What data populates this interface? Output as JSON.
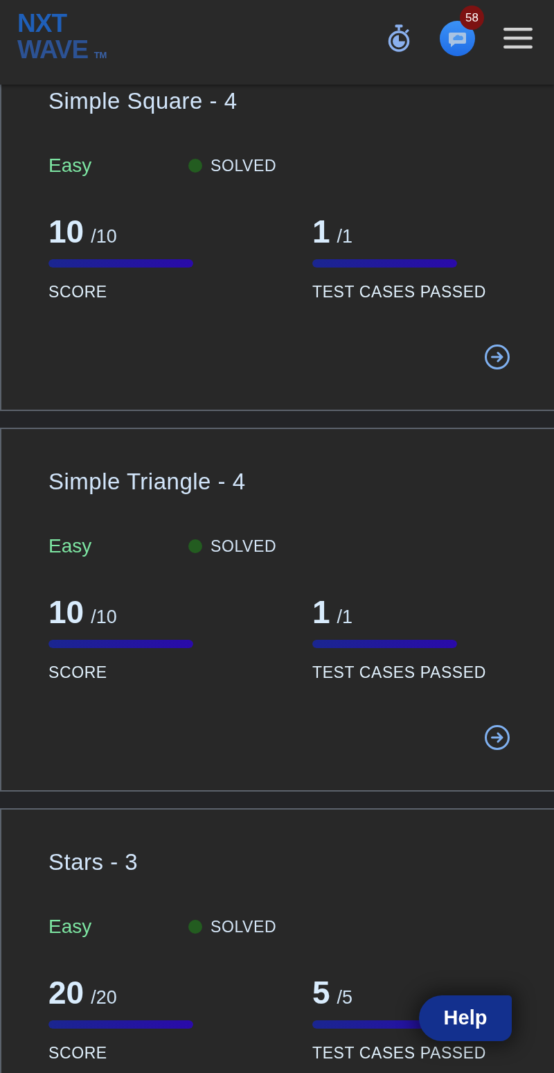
{
  "header": {
    "logo": {
      "line_1": "NXT",
      "line_2": "WAVE",
      "trademark": "TM"
    },
    "chat_badge": "58"
  },
  "problems": [
    {
      "title": "Simple Square - 4",
      "difficulty": "Easy",
      "status": {
        "label": "SOLVED",
        "color": "#235c20"
      },
      "metrics": [
        {
          "value": "10",
          "total": "/10",
          "label": "SCORE",
          "level": 1
        },
        {
          "value": "1",
          "total": "/1",
          "label": "TEST CASES PASSED",
          "level": 1
        }
      ]
    },
    {
      "title": "Simple Triangle - 4",
      "difficulty": "Easy",
      "status": {
        "label": "SOLVED",
        "color": "#235c20"
      },
      "metrics": [
        {
          "value": "10",
          "total": "/10",
          "label": "SCORE",
          "level": 1
        },
        {
          "value": "1",
          "total": "/1",
          "label": "TEST CASES PASSED",
          "level": 1
        }
      ]
    },
    {
      "title": "Stars - 3",
      "difficulty": "Easy",
      "status": {
        "label": "SOLVED",
        "color": "#235c20"
      },
      "metrics": [
        {
          "value": "20",
          "total": "/20",
          "label": "SCORE",
          "level": 1
        },
        {
          "value": "5",
          "total": "/5",
          "label": "TEST CASES PASSED",
          "level": 1
        }
      ]
    }
  ],
  "help_button": {
    "label": "Help"
  }
}
